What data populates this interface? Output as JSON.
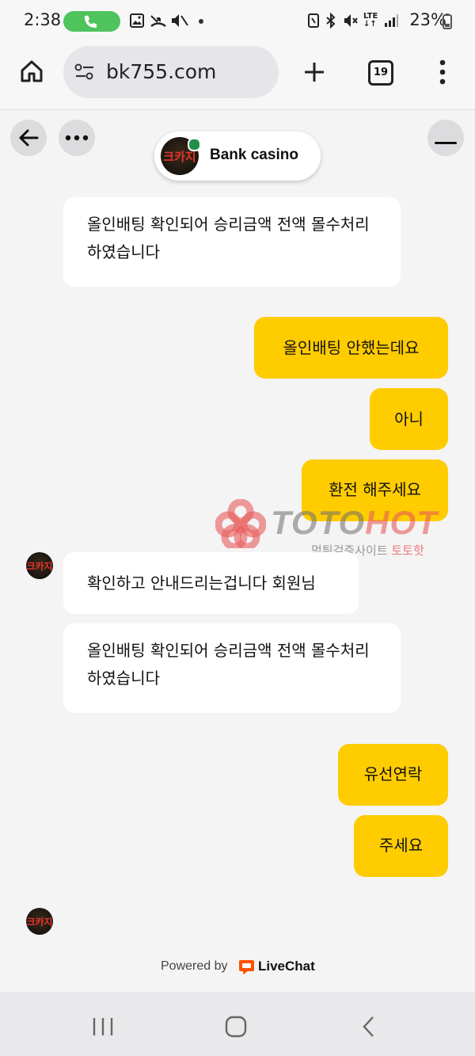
{
  "status_bar": {
    "time": "2:38",
    "battery_text": "23%"
  },
  "browser": {
    "url": "bk755.com",
    "tab_count": "19"
  },
  "chat": {
    "agent_name": "Bank casino",
    "avatar_text": "크카지",
    "messages": [
      {
        "side": "in",
        "text": "올인배팅 확인되어 승리금액 전액 몰수처리 하였습니다"
      },
      {
        "side": "out",
        "text": "올인배팅 안했는데요"
      },
      {
        "side": "out",
        "text": "아니"
      },
      {
        "side": "out",
        "text": "환전 해주세요"
      },
      {
        "side": "in",
        "text": "확인하고 안내드리는겁니다 회원님"
      },
      {
        "side": "in",
        "text": "올인배팅 확인되어 승리금액 전액 몰수처리 하였습니다"
      },
      {
        "side": "out",
        "text": "유선연락"
      },
      {
        "side": "out",
        "text": "주세요"
      }
    ],
    "footer": {
      "powered_by": "Powered by",
      "brand": "LiveChat"
    }
  },
  "watermark": {
    "main_a": "TOTO",
    "main_b": "HOT",
    "sub_a": "먹튀검증사이트 ",
    "sub_b": "토토핫"
  },
  "colors": {
    "bubble_out": "#ffcc00",
    "bubble_in": "#ffffff",
    "online": "#1f8f4a",
    "livechat": "#ff5100"
  }
}
